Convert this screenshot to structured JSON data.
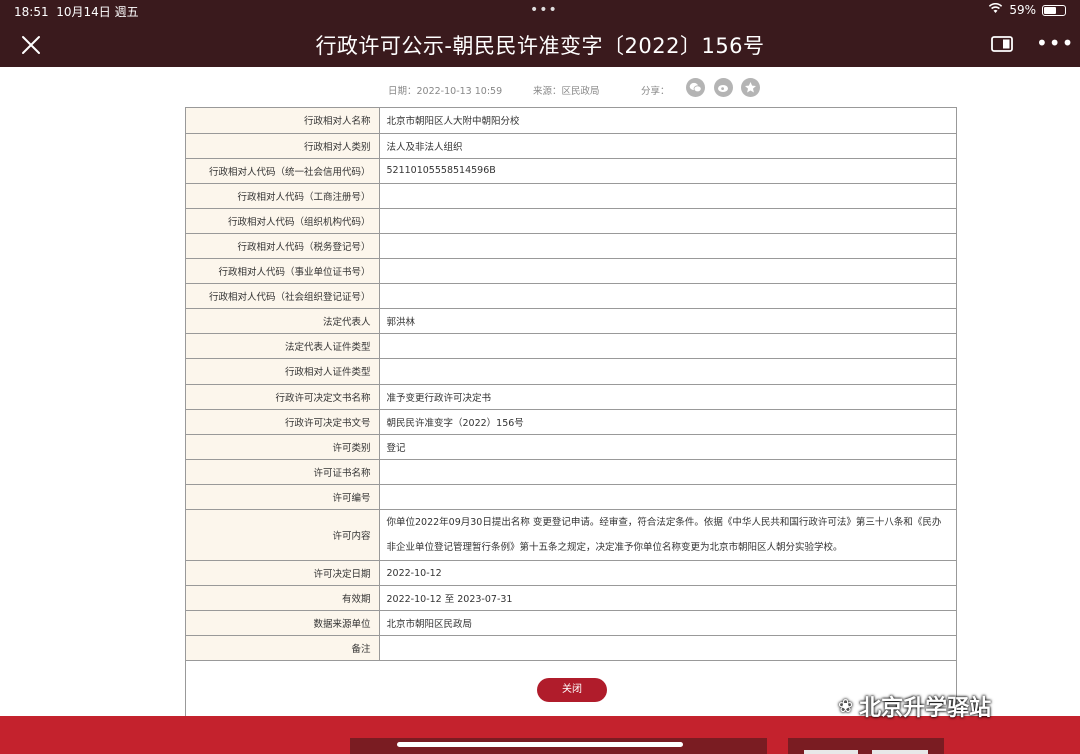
{
  "status_bar": {
    "time": "18:51",
    "date": "10月14日 週五",
    "battery": "59%",
    "battery_level": 0.59
  },
  "nav": {
    "title": "行政许可公示-朝民民许准变字〔2022〕156号",
    "close_icon": "close-icon",
    "reader_icon": "reader-mode-icon",
    "more_icon": "more-icon"
  },
  "meta": {
    "date": "日期：2022-10-13 10:59",
    "source": "来源：区民政局",
    "share": "分享：",
    "share_icons": [
      "wechat-icon",
      "weibo-icon",
      "favorite-icon"
    ]
  },
  "rows": [
    {
      "label": "行政相对人名称",
      "value": "北京市朝阳区人大附中朝阳分校"
    },
    {
      "label": "行政相对人类别",
      "value": "法人及非法人组织"
    },
    {
      "label": "行政相对人代码（统一社会信用代码）",
      "value": "52110105558514596B"
    },
    {
      "label": "行政相对人代码（工商注册号）",
      "value": ""
    },
    {
      "label": "行政相对人代码（组织机构代码）",
      "value": ""
    },
    {
      "label": "行政相对人代码（税务登记号）",
      "value": ""
    },
    {
      "label": "行政相对人代码（事业单位证书号）",
      "value": ""
    },
    {
      "label": "行政相对人代码（社会组织登记证号）",
      "value": ""
    },
    {
      "label": "法定代表人",
      "value": "郭洪林"
    },
    {
      "label": "法定代表人证件类型",
      "value": ""
    },
    {
      "label": "行政相对人证件类型",
      "value": ""
    },
    {
      "label": "行政许可决定文书名称",
      "value": "准予变更行政许可决定书"
    },
    {
      "label": "行政许可决定书文号",
      "value": "朝民民许准变字（2022）156号"
    },
    {
      "label": "许可类别",
      "value": "登记"
    },
    {
      "label": "许可证书名称",
      "value": ""
    },
    {
      "label": "许可编号",
      "value": ""
    },
    {
      "label": "许可内容",
      "value": "你单位2022年09月30日提出名称 变更登记申请。经审查，符合法定条件。依据《中华人民共和国行政许可法》第三十八条和《民办非企业单位登记管理暂行条例》第十五条之规定，决定准予你单位名称变更为北京市朝阳区人朝分实验学校。",
      "tall": true
    },
    {
      "label": "许可决定日期",
      "value": "2022-10-12"
    },
    {
      "label": "有效期",
      "value": "2022-10-12 至 2023-07-31"
    },
    {
      "label": "数据来源单位",
      "value": "北京市朝阳区民政局"
    },
    {
      "label": "备注",
      "value": ""
    }
  ],
  "close_button": "关闭",
  "watermark": "北京升学驿站",
  "colors": {
    "topbar": "#3a1a1d",
    "label_bg": "#fcf6ec",
    "button": "#b01c2b",
    "bottombar": "#c4222d"
  }
}
